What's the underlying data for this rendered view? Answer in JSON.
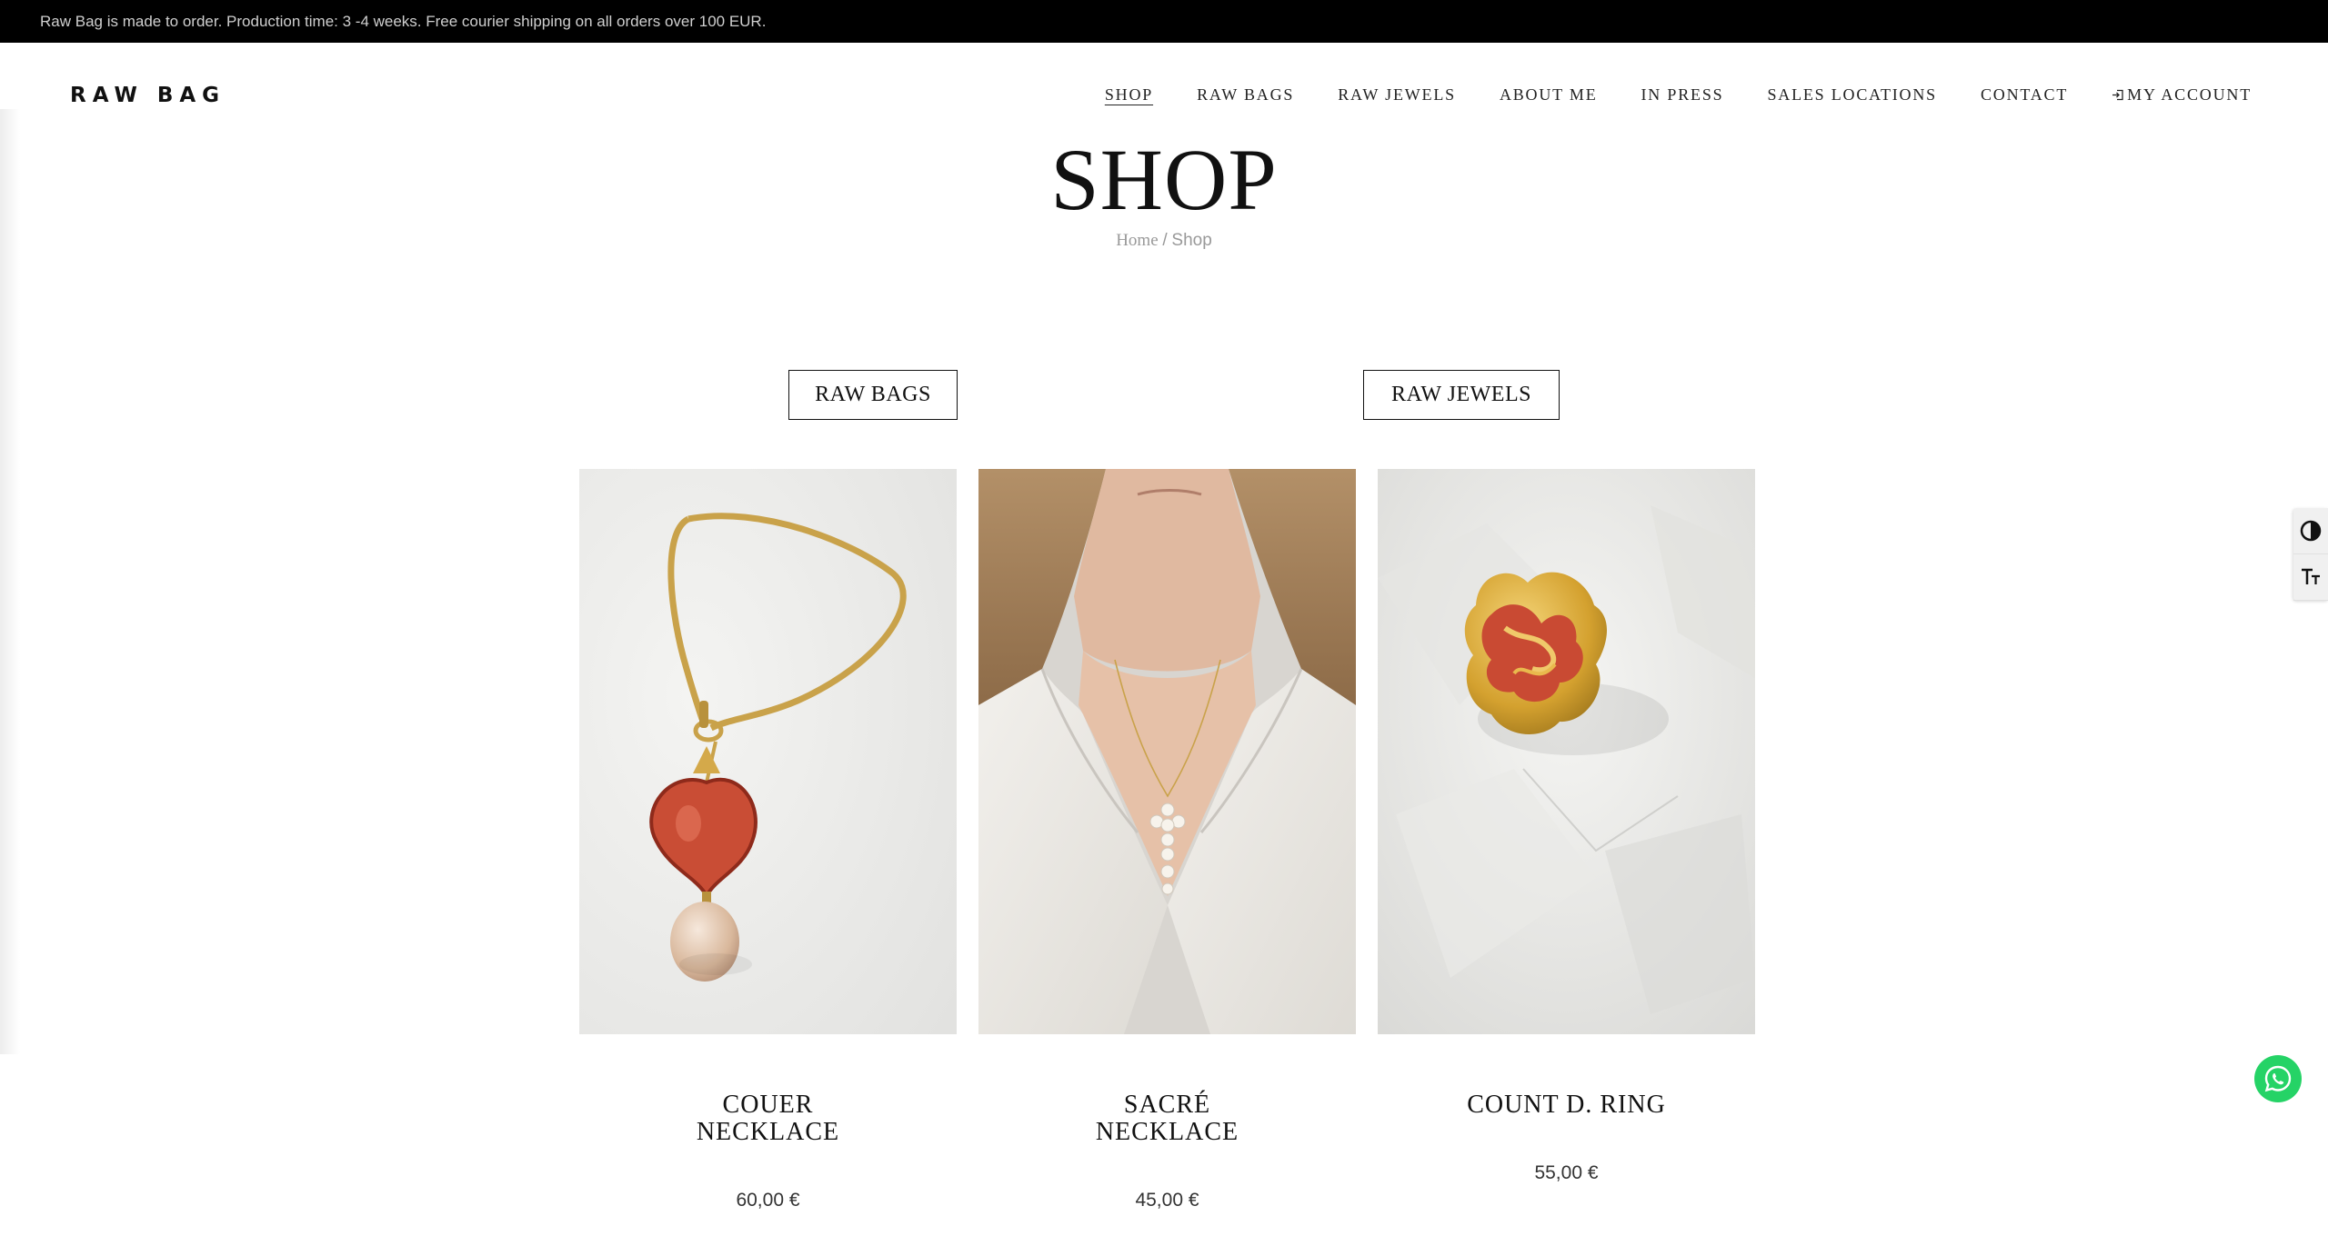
{
  "announcement": "Raw Bag is made to order. Production time: 3 -4 weeks. Free courier shipping on all orders over 100 EUR.",
  "brand": {
    "logo": "RAW BAG"
  },
  "nav": {
    "items": [
      "SHOP",
      "RAW BAGS",
      "RAW JEWELS",
      "ABOUT ME",
      "IN PRESS",
      "SALES LOCATIONS",
      "CONTACT"
    ],
    "account_label": "MY ACCOUNT",
    "account_icon": "login-icon",
    "active": "SHOP"
  },
  "page": {
    "title": "SHOP",
    "breadcrumb": {
      "home": "Home",
      "separator": "/",
      "current": "Shop"
    }
  },
  "categories": [
    "RAW BAGS",
    "RAW JEWELS"
  ],
  "products": [
    {
      "name": "COUER\nNECKLACE",
      "price": "60,00 €",
      "image": "gold chain necklace with red enamel heart and baroque pearl pendant"
    },
    {
      "name": "SACRÉ\nNECKLACE",
      "price": "45,00 €",
      "image": "woman in white shirt wearing pearl cross necklace"
    },
    {
      "name": "COUNT D. RING",
      "price": "55,00 €",
      "image": "gold and red enamel crumpled ring on white fabric"
    }
  ],
  "tools": [
    "contrast-icon",
    "font-size-icon"
  ],
  "chat": {
    "icon": "whatsapp-icon",
    "color": "#25D366"
  }
}
